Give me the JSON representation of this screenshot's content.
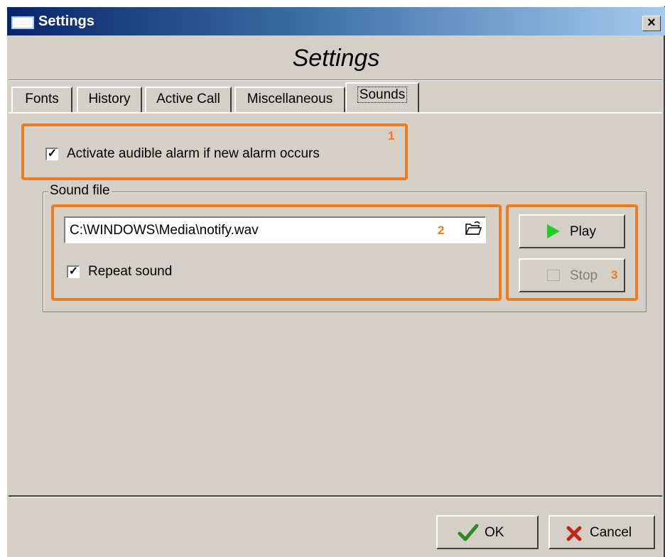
{
  "window": {
    "title": "Settings",
    "header_title": "Settings",
    "close_glyph": "×",
    "icon": "window-icon"
  },
  "tabs": [
    {
      "label": "Fonts"
    },
    {
      "label": "History"
    },
    {
      "label": "Active Call"
    },
    {
      "label": "Miscellaneous"
    },
    {
      "label": "Sounds",
      "active": true
    }
  ],
  "sounds": {
    "alarm_checkbox": {
      "checked": true,
      "label": "Activate audible alarm if new alarm occurs"
    },
    "group_label": "Sound file",
    "file_path": "C:\\WINDOWS\\Media\\notify.wav",
    "repeat_checkbox": {
      "checked": true,
      "label": "Repeat sound"
    },
    "play_label": "Play",
    "stop_label": "Stop",
    "stop_enabled": false
  },
  "annotations": {
    "marker1": "1",
    "marker2": "2",
    "marker3": "3",
    "color": "#f07a1e"
  },
  "footer": {
    "ok_label": "OK",
    "cancel_label": "Cancel"
  },
  "check_mark": "✓"
}
